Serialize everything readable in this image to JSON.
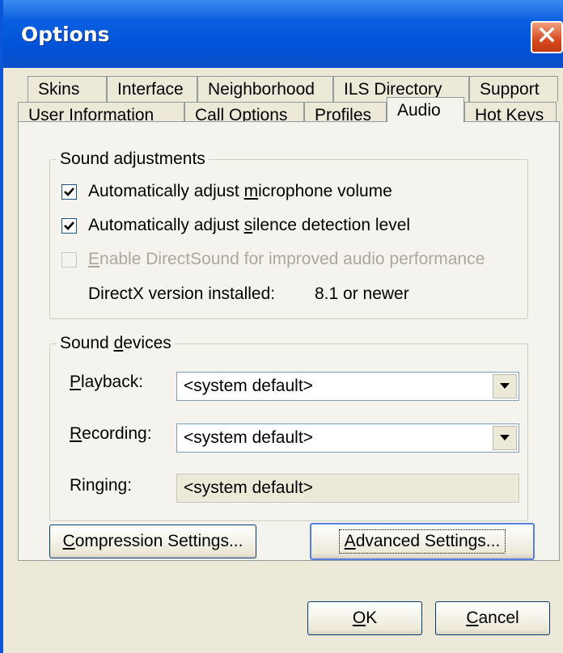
{
  "window": {
    "title": "Options",
    "close_icon": "close-icon",
    "colors": {
      "titlebar": "#0052d6",
      "close": "#d84a20",
      "face": "#ece9d8"
    }
  },
  "tabs": {
    "row1": [
      "Skins",
      "Interface",
      "Neighborhood",
      "ILS Directory",
      "Support"
    ],
    "row2": [
      "User Information",
      "Call Options",
      "Profiles",
      "Audio",
      "Hot Keys"
    ],
    "active": "Audio"
  },
  "sound_adjustments": {
    "label": "Sound adjustments",
    "mic": {
      "pre": "Automatically adjust ",
      "key": "m",
      "post": "icrophone volume",
      "checked": true
    },
    "silence": {
      "pre": "Automatically adjust ",
      "key": "s",
      "post": "ilence detection level",
      "checked": true
    },
    "directsound": {
      "pre": "",
      "key": "E",
      "post": "nable DirectSound for improved audio performance",
      "checked": false,
      "enabled": false
    },
    "directx_label": "DirectX version installed:",
    "directx_value": "8.1 or newer"
  },
  "sound_devices": {
    "label_pre": "Sound ",
    "label_key": "d",
    "label_post": "evices",
    "playback": {
      "key": "P",
      "post": "layback:",
      "value": "<system default>"
    },
    "recording": {
      "key": "R",
      "post": "ecording:",
      "value": "<system default>"
    },
    "ringing": {
      "label": "Ringing:",
      "value": "<system default>"
    }
  },
  "buttons": {
    "compression": {
      "key": "C",
      "post": "ompression Settings..."
    },
    "advanced": {
      "key": "A",
      "post": "dvanced Settings..."
    },
    "ok": {
      "key": "O",
      "post": "K"
    },
    "cancel": {
      "key": "C",
      "post": "ancel"
    }
  }
}
